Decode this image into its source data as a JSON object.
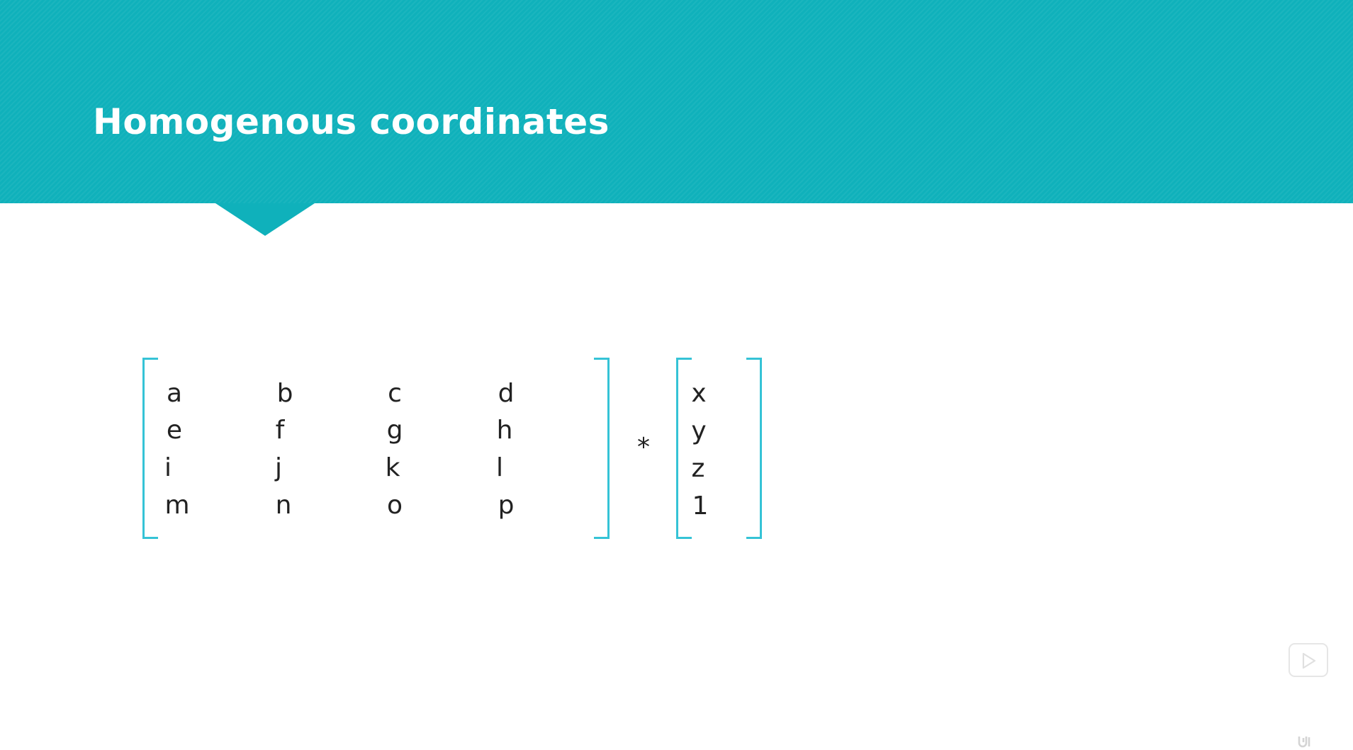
{
  "slide": {
    "title": "Homogenous coordinates",
    "header_color": "#0fb1bb",
    "bracket_color": "#35c3d6"
  },
  "matrix": {
    "rows": [
      [
        "a",
        "b",
        "c",
        "d"
      ],
      [
        "e",
        "f",
        "g",
        "h"
      ],
      [
        "i",
        "j",
        "k",
        "l"
      ],
      [
        "m",
        "n",
        "o",
        "p"
      ]
    ]
  },
  "operator": "*",
  "vector": [
    "x",
    "y",
    "z",
    "1"
  ],
  "controls": {
    "play_icon": "play-icon"
  },
  "watermark": {
    "icon": "udemy-logo"
  }
}
